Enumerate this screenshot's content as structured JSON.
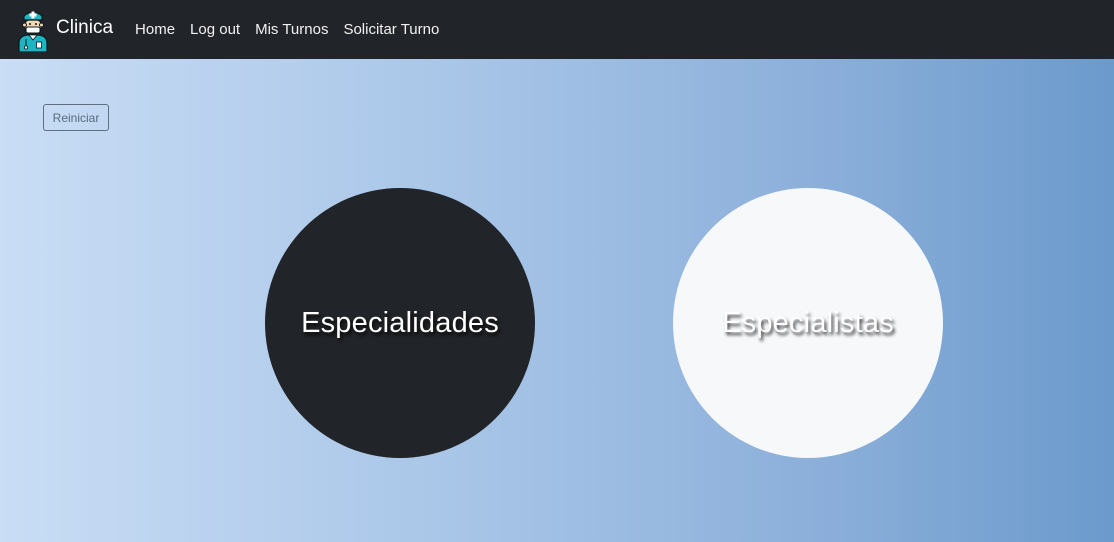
{
  "navbar": {
    "brand": "Clinica",
    "logo_icon": "doctor-avatar-icon",
    "links": [
      "Home",
      "Log out",
      "Mis Turnos",
      "Solicitar Turno"
    ]
  },
  "main": {
    "reset_label": "Reiniciar",
    "options": [
      {
        "label": "Especialidades",
        "style": "dark"
      },
      {
        "label": "Especialistas",
        "style": "light"
      }
    ]
  },
  "colors": {
    "navbar_bg": "#212428",
    "gradient_start": "#c9ddf5",
    "gradient_end": "#6b9acc",
    "dark_circle": "#212428",
    "light_circle": "#f7f8fa",
    "logo_accent": "#1cb5c4"
  }
}
